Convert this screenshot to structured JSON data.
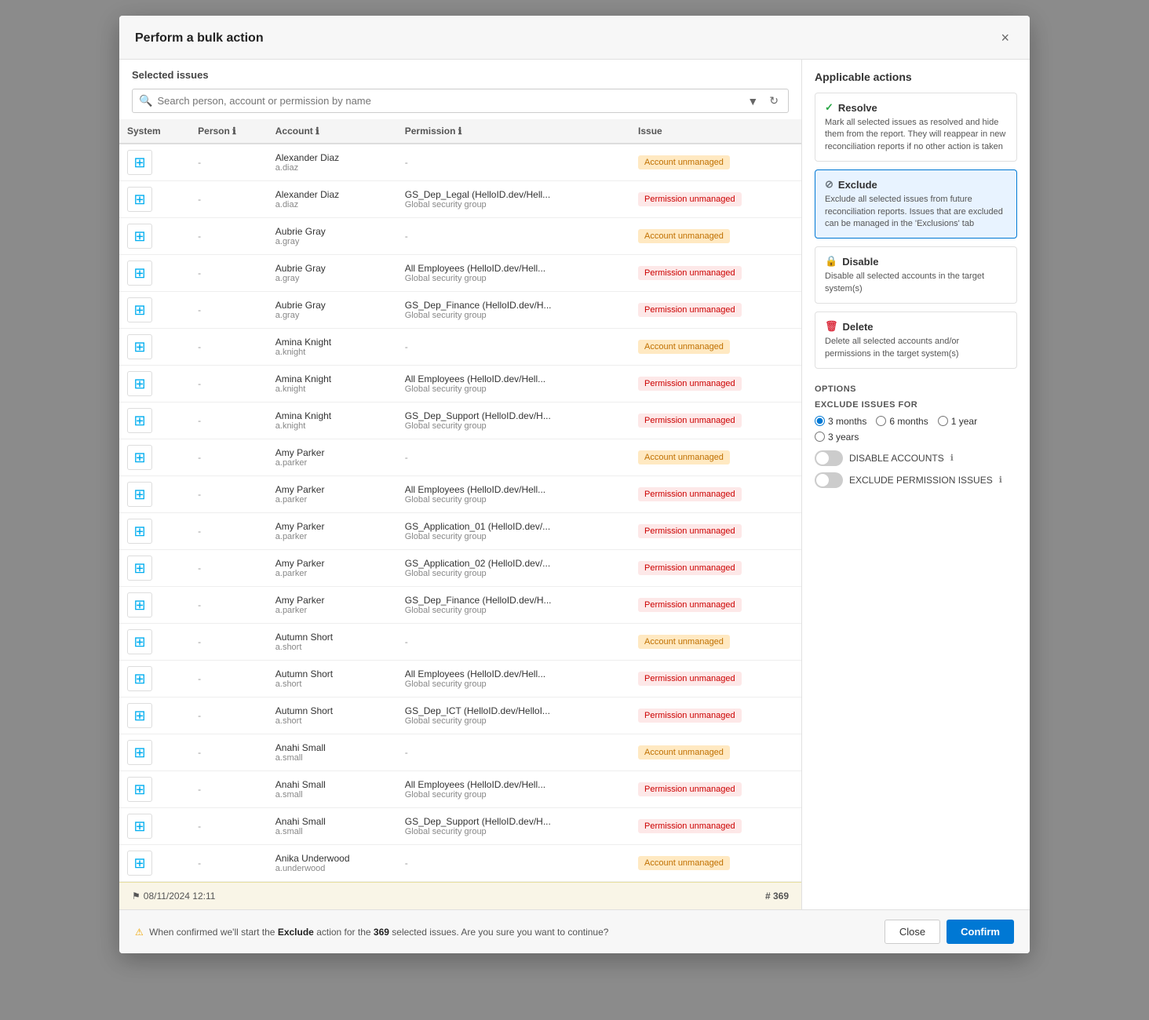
{
  "modal": {
    "title": "Perform a bulk action",
    "close_label": "×"
  },
  "left_panel": {
    "section_title": "Selected issues",
    "search_placeholder": "Search person, account or permission by name",
    "columns": [
      "System",
      "Person",
      "Account",
      "Permission",
      "Issue"
    ],
    "rows": [
      {
        "system": "Windows",
        "person_name": "Alexander Diaz",
        "person_user": "a.diaz",
        "account": "-",
        "account_sub": "",
        "issue_type": "account_unmanaged"
      },
      {
        "system": "Windows",
        "person_name": "Alexander Diaz",
        "person_user": "a.diaz",
        "account": "GS_Dep_Legal (HelloID.dev/Hell...",
        "account_sub": "Global security group",
        "issue_type": "permission_unmanaged"
      },
      {
        "system": "Windows",
        "person_name": "Aubrie Gray",
        "person_user": "a.gray",
        "account": "-",
        "account_sub": "",
        "issue_type": "account_unmanaged"
      },
      {
        "system": "Windows",
        "person_name": "Aubrie Gray",
        "person_user": "a.gray",
        "account": "All Employees (HelloID.dev/Hell...",
        "account_sub": "Global security group",
        "issue_type": "permission_unmanaged"
      },
      {
        "system": "Windows",
        "person_name": "Aubrie Gray",
        "person_user": "a.gray",
        "account": "GS_Dep_Finance (HelloID.dev/H...",
        "account_sub": "Global security group",
        "issue_type": "permission_unmanaged"
      },
      {
        "system": "Windows",
        "person_name": "Amina Knight",
        "person_user": "a.knight",
        "account": "-",
        "account_sub": "",
        "issue_type": "account_unmanaged"
      },
      {
        "system": "Windows",
        "person_name": "Amina Knight",
        "person_user": "a.knight",
        "account": "All Employees (HelloID.dev/Hell...",
        "account_sub": "Global security group",
        "issue_type": "permission_unmanaged"
      },
      {
        "system": "Windows",
        "person_name": "Amina Knight",
        "person_user": "a.knight",
        "account": "GS_Dep_Support (HelloID.dev/H...",
        "account_sub": "Global security group",
        "issue_type": "permission_unmanaged"
      },
      {
        "system": "Windows",
        "person_name": "Amy Parker",
        "person_user": "a.parker",
        "account": "-",
        "account_sub": "",
        "issue_type": "account_unmanaged"
      },
      {
        "system": "Windows",
        "person_name": "Amy Parker",
        "person_user": "a.parker",
        "account": "All Employees (HelloID.dev/Hell...",
        "account_sub": "Global security group",
        "issue_type": "permission_unmanaged"
      },
      {
        "system": "Windows",
        "person_name": "Amy Parker",
        "person_user": "a.parker",
        "account": "GS_Application_01 (HelloID.dev/...",
        "account_sub": "Global security group",
        "issue_type": "permission_unmanaged"
      },
      {
        "system": "Windows",
        "person_name": "Amy Parker",
        "person_user": "a.parker",
        "account": "GS_Application_02 (HelloID.dev/...",
        "account_sub": "Global security group",
        "issue_type": "permission_unmanaged"
      },
      {
        "system": "Windows",
        "person_name": "Amy Parker",
        "person_user": "a.parker",
        "account": "GS_Dep_Finance (HelloID.dev/H...",
        "account_sub": "Global security group",
        "issue_type": "permission_unmanaged"
      },
      {
        "system": "Windows",
        "person_name": "Autumn Short",
        "person_user": "a.short",
        "account": "-",
        "account_sub": "",
        "issue_type": "account_unmanaged"
      },
      {
        "system": "Windows",
        "person_name": "Autumn Short",
        "person_user": "a.short",
        "account": "All Employees (HelloID.dev/Hell...",
        "account_sub": "Global security group",
        "issue_type": "permission_unmanaged"
      },
      {
        "system": "Windows",
        "person_name": "Autumn Short",
        "person_user": "a.short",
        "account": "GS_Dep_ICT (HelloID.dev/HelloI...",
        "account_sub": "Global security group",
        "issue_type": "permission_unmanaged"
      },
      {
        "system": "Windows",
        "person_name": "Anahi Small",
        "person_user": "a.small",
        "account": "-",
        "account_sub": "",
        "issue_type": "account_unmanaged"
      },
      {
        "system": "Windows",
        "person_name": "Anahi Small",
        "person_user": "a.small",
        "account": "All Employees (HelloID.dev/Hell...",
        "account_sub": "Global security group",
        "issue_type": "permission_unmanaged"
      },
      {
        "system": "Windows",
        "person_name": "Anahi Small",
        "person_user": "a.small",
        "account": "GS_Dep_Support (HelloID.dev/H...",
        "account_sub": "Global security group",
        "issue_type": "permission_unmanaged"
      },
      {
        "system": "Windows",
        "person_name": "Anika Underwood",
        "person_user": "a.underwood",
        "account": "-",
        "account_sub": "",
        "issue_type": "account_unmanaged"
      }
    ],
    "issue_labels": {
      "account_unmanaged": "Account unmanaged",
      "permission_unmanaged": "Permission unmanaged"
    },
    "footer_timestamp": "08/11/2024 12:11",
    "footer_count": "# 369"
  },
  "right_panel": {
    "title": "Applicable actions",
    "actions": [
      {
        "id": "resolve",
        "icon": "✓",
        "label": "Resolve",
        "description": "Mark all selected issues as resolved and hide them from the report. They will reappear in new reconciliation reports if no other action is taken",
        "selected": false
      },
      {
        "id": "exclude",
        "icon": "⊘",
        "label": "Exclude",
        "description": "Exclude all selected issues from future reconciliation reports. Issues that are excluded can be managed in the 'Exclusions' tab",
        "selected": true
      },
      {
        "id": "disable",
        "icon": "🔒",
        "label": "Disable",
        "description": "Disable all selected accounts in the target system(s)",
        "selected": false
      },
      {
        "id": "delete",
        "icon": "🗑",
        "label": "Delete",
        "description": "Delete all selected accounts and/or permissions in the target system(s)",
        "selected": false
      }
    ],
    "options_title": "Options",
    "exclude_label": "EXCLUDE ISSUES FOR",
    "duration_options": [
      "3 months",
      "6 months",
      "1 year",
      "3 years"
    ],
    "selected_duration": "3 months",
    "disable_accounts_label": "DISABLE ACCOUNTS",
    "exclude_permission_label": "EXCLUDE PERMISSION ISSUES"
  },
  "footer": {
    "warning_prefix": "When confirmed we'll start the",
    "action_name": "Exclude",
    "warning_suffix": "action for the",
    "count": "369",
    "warning_end": "selected issues. Are you sure you want to continue?",
    "close_label": "Close",
    "confirm_label": "Confirm"
  }
}
